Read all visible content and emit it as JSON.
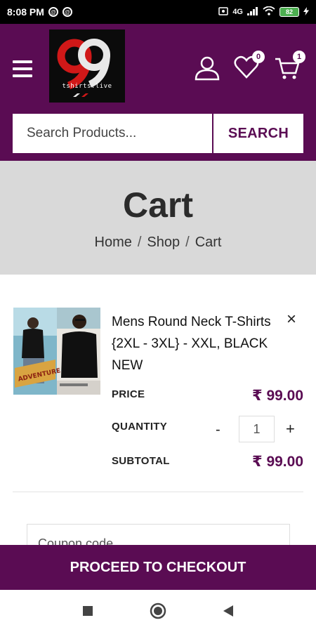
{
  "status_bar": {
    "time": "8:08 PM",
    "network": "4G",
    "battery": "82"
  },
  "header": {
    "logo_text": "tshirts.live",
    "wishlist_count": "0",
    "cart_count": "1"
  },
  "search": {
    "placeholder": "Search Products...",
    "button_label": "SEARCH"
  },
  "banner": {
    "title": "Cart",
    "breadcrumb": [
      "Home",
      "Shop",
      "Cart"
    ],
    "separator": "/"
  },
  "cart_item": {
    "name": "Mens Round Neck T-Shirts {2XL - 3XL} - XXL, BLACK NEW",
    "remove_symbol": "×",
    "price_label": "PRICE",
    "price": "₹ 99.00",
    "quantity_label": "QUANTITY",
    "quantity": "1",
    "minus_symbol": "-",
    "plus_symbol": "+",
    "subtotal_label": "SUBTOTAL",
    "subtotal": "₹ 99.00",
    "thumbnail_text": "ADVENTURE"
  },
  "coupon": {
    "placeholder": "Coupon code"
  },
  "checkout": {
    "button_label": "PROCEED TO CHECKOUT"
  },
  "colors": {
    "brand": "#5a0c53",
    "banner_bg": "#d9d9d9"
  }
}
